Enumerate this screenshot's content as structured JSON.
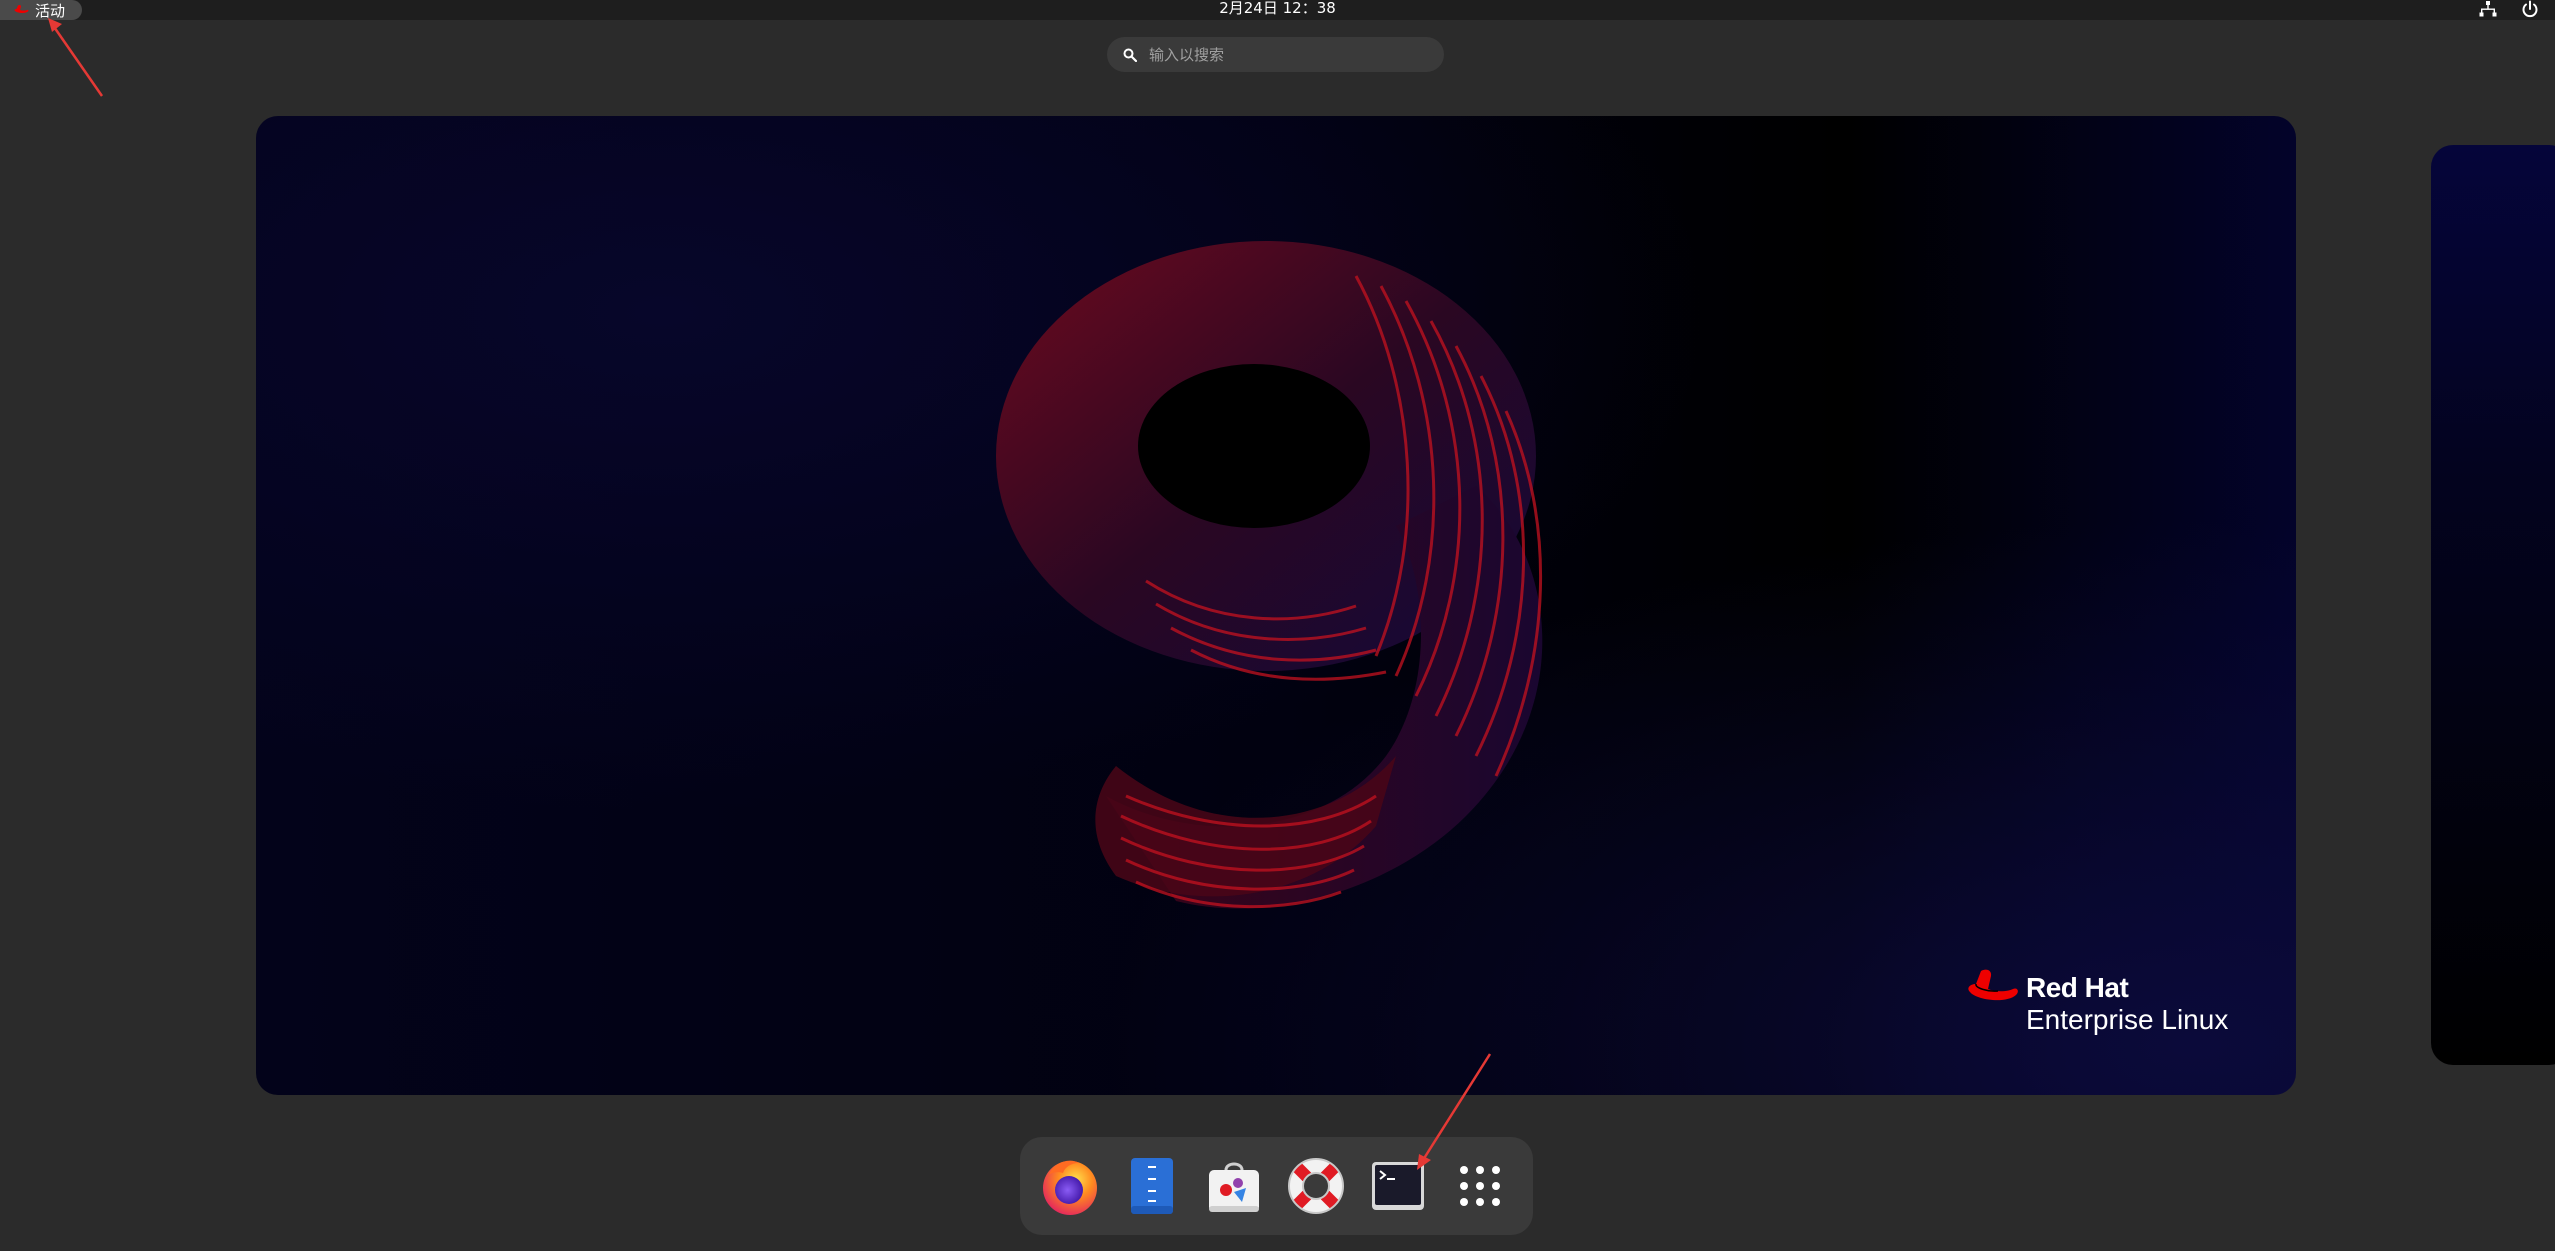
{
  "topbar": {
    "activities_label": "活动",
    "clock": "2月24日 12：38",
    "tray": [
      "network-icon",
      "power-icon"
    ]
  },
  "search": {
    "placeholder": "输入以搜索"
  },
  "wallpaper": {
    "brand_name": "Red Hat",
    "product_name": "Enterprise Linux"
  },
  "dash": {
    "apps": [
      {
        "name": "firefox",
        "icon": "firefox-icon"
      },
      {
        "name": "text-editor",
        "icon": "text-editor-icon"
      },
      {
        "name": "software",
        "icon": "software-store-icon"
      },
      {
        "name": "help",
        "icon": "help-lifebuoy-icon"
      },
      {
        "name": "terminal",
        "icon": "terminal-icon"
      },
      {
        "name": "show-apps",
        "icon": "app-grid-icon"
      }
    ]
  },
  "colors": {
    "panel": "#1e1e1e",
    "dash": "#3a3a3a",
    "accent_red": "#ee0000",
    "annotation_arrow": "#e53935"
  }
}
